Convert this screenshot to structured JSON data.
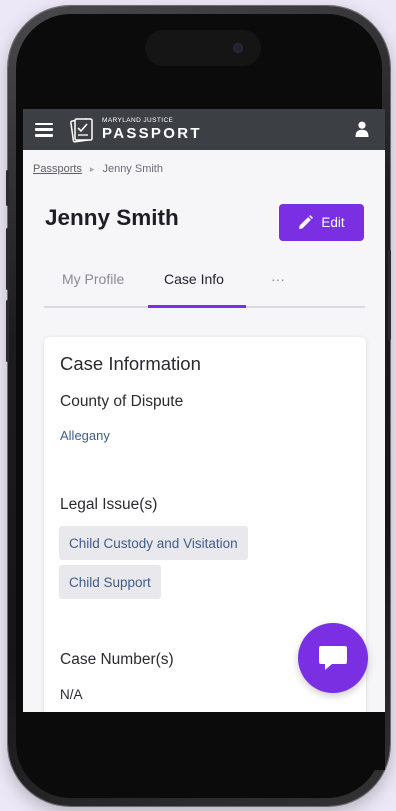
{
  "header": {
    "logo_small": "MARYLAND JUSTICE",
    "logo_big": "PASSPORT"
  },
  "breadcrumb": {
    "parent": "Passports",
    "separator": "▸",
    "current": "Jenny Smith"
  },
  "page": {
    "title": "Jenny Smith",
    "edit_label": "Edit"
  },
  "tabs": [
    {
      "label": "My Profile",
      "active": false
    },
    {
      "label": "Case Info",
      "active": true
    },
    {
      "label": "···",
      "active": false
    }
  ],
  "case_info": {
    "title": "Case Information",
    "county_label": "County of Dispute",
    "county_value": "Allegany",
    "legal_issues_label": "Legal Issue(s)",
    "legal_issues": [
      "Child Custody and Visitation",
      "Child Support"
    ],
    "case_numbers_label": "Case Number(s)",
    "case_numbers_value": "N/A"
  },
  "colors": {
    "accent": "#7a2fe3",
    "topbar": "#3c3f44",
    "link": "#3f5d8a"
  },
  "icons": {
    "menu": "hamburger-menu-icon",
    "logo": "passport-checklist-icon",
    "user": "user-icon",
    "edit": "pencil-icon",
    "chat": "chat-bubble-icon"
  }
}
